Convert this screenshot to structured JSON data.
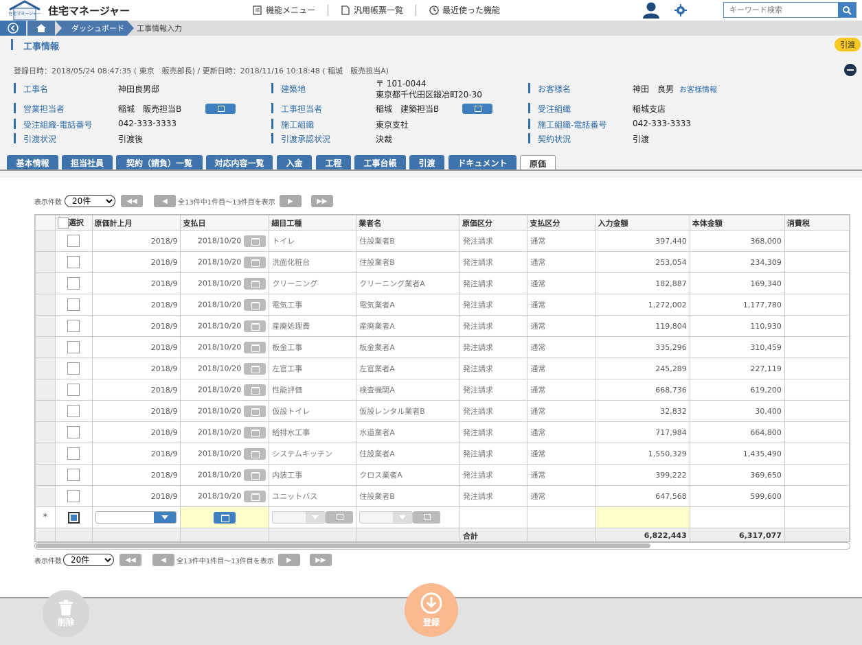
{
  "app": {
    "title": "住宅マネージャー",
    "logo_text": "住宅マネージャー"
  },
  "menu": {
    "func_menu": "機能メニュー",
    "reports": "汎用帳票一覧",
    "recent": "最近使った機能"
  },
  "search": {
    "placeholder": "キーワード検索"
  },
  "breadcrumb": {
    "dashboard": "ダッシュボード",
    "current": "工事情報入力"
  },
  "section": {
    "title": "工事情報",
    "badge": "引渡"
  },
  "meta": "登録日時：2018/05/24 08:47:35 ( 東京　販売部長) / 更新日時：2018/11/16 10:18:48 ( 稲城　販売担当A)",
  "fields": {
    "koji_name_label": "工事名",
    "koji_name": "神田良男邸",
    "site_label": "建築地",
    "site_zip": "〒 101-0044",
    "site_addr": "東京都千代田区鍛冶町20-30",
    "customer_label": "お客様名",
    "customer": "神田　良男",
    "customer_link": "お客様情報",
    "sales_label": "営業担当者",
    "sales": "稲城　販売担当B",
    "const_label": "工事担当者",
    "const": "稲城　建築担当B",
    "order_org_label": "受注組織",
    "order_org": "稲城支店",
    "order_tel_label": "受注組織-電話番号",
    "order_tel": "042-333-3333",
    "build_org_label": "施工組織",
    "build_org": "東京支社",
    "build_tel_label": "施工組織-電話番号",
    "build_tel": "042-333-3333",
    "handover_label": "引渡状況",
    "handover": "引渡後",
    "approval_label": "引渡承認状況",
    "approval": "決裁",
    "contract_label": "契約状況",
    "contract": "引渡"
  },
  "tabs": [
    "基本情報",
    "担当社員",
    "契約（請負）一覧",
    "対応内容一覧",
    "入金",
    "工程",
    "工事台帳",
    "引渡",
    "ドキュメント",
    "原価"
  ],
  "pager": {
    "label": "表示件数",
    "size": "20件",
    "summary": "全13件中1件目～13件目を表示"
  },
  "columns": [
    "選択",
    "原価計上月",
    "支払日",
    "細目工種",
    "業者名",
    "原価区分",
    "支払区分",
    "入力金額",
    "本体金額",
    "消費税"
  ],
  "rows": [
    {
      "month": "2018/9",
      "pay": "2018/10/20",
      "work": "トイレ",
      "vendor": "住設業者B",
      "cost": "発注請求",
      "paytype": "通常",
      "input": "397,440",
      "body": "368,000"
    },
    {
      "month": "2018/9",
      "pay": "2018/10/20",
      "work": "洗面化粧台",
      "vendor": "住設業者B",
      "cost": "発注請求",
      "paytype": "通常",
      "input": "253,054",
      "body": "234,309"
    },
    {
      "month": "2018/9",
      "pay": "2018/10/20",
      "work": "クリーニング",
      "vendor": "クリーニング業者A",
      "cost": "発注請求",
      "paytype": "通常",
      "input": "182,887",
      "body": "169,340"
    },
    {
      "month": "2018/9",
      "pay": "2018/10/20",
      "work": "電気工事",
      "vendor": "電気業者A",
      "cost": "発注請求",
      "paytype": "通常",
      "input": "1,272,002",
      "body": "1,177,780"
    },
    {
      "month": "2018/9",
      "pay": "2018/10/20",
      "work": "産廃処理費",
      "vendor": "産廃業者A",
      "cost": "発注請求",
      "paytype": "通常",
      "input": "119,804",
      "body": "110,930"
    },
    {
      "month": "2018/9",
      "pay": "2018/10/20",
      "work": "板金工事",
      "vendor": "板金業者A",
      "cost": "発注請求",
      "paytype": "通常",
      "input": "335,296",
      "body": "310,459"
    },
    {
      "month": "2018/9",
      "pay": "2018/10/20",
      "work": "左官工事",
      "vendor": "左官業者A",
      "cost": "発注請求",
      "paytype": "通常",
      "input": "245,289",
      "body": "227,119"
    },
    {
      "month": "2018/9",
      "pay": "2018/10/20",
      "work": "性能評価",
      "vendor": "検査機関A",
      "cost": "発注請求",
      "paytype": "通常",
      "input": "668,736",
      "body": "619,200"
    },
    {
      "month": "2018/9",
      "pay": "2018/10/20",
      "work": "仮設トイレ",
      "vendor": "仮設レンタル業者B",
      "cost": "発注請求",
      "paytype": "通常",
      "input": "32,832",
      "body": "30,400"
    },
    {
      "month": "2018/9",
      "pay": "2018/10/20",
      "work": "給排水工事",
      "vendor": "水道業者A",
      "cost": "発注請求",
      "paytype": "通常",
      "input": "717,984",
      "body": "664,800"
    },
    {
      "month": "2018/9",
      "pay": "2018/10/20",
      "work": "システムキッチン",
      "vendor": "住設業者A",
      "cost": "発注請求",
      "paytype": "通常",
      "input": "1,550,329",
      "body": "1,435,490"
    },
    {
      "month": "2018/9",
      "pay": "2018/10/20",
      "work": "内装工事",
      "vendor": "クロス業者A",
      "cost": "発注請求",
      "paytype": "通常",
      "input": "399,222",
      "body": "369,650"
    },
    {
      "month": "2018/9",
      "pay": "2018/10/20",
      "work": "ユニットバス",
      "vendor": "住設業者B",
      "cost": "発注請求",
      "paytype": "通常",
      "input": "647,568",
      "body": "599,600"
    }
  ],
  "newrow_marker": "*",
  "total": {
    "label": "合計",
    "input": "6,822,443",
    "body": "6,317,077"
  },
  "buttons": {
    "delete": "削除",
    "register": "登録"
  },
  "colors": {
    "accent": "#3f73ac",
    "badge": "#f7c824",
    "register": "#f9b98f"
  }
}
